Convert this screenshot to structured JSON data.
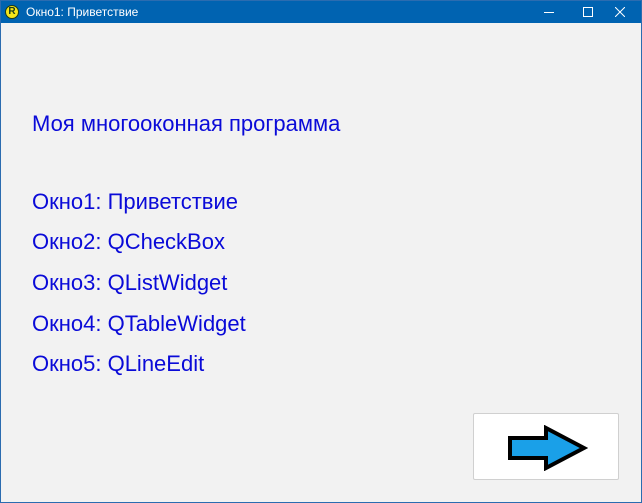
{
  "window": {
    "title": "Окно1: Приветствие",
    "app_icon_letter": "R",
    "controls": [
      "minimize-icon",
      "maximize-icon",
      "close-icon"
    ]
  },
  "main": {
    "heading": "Моя многооконная программа",
    "windows_list": [
      "Окно1: Приветствие",
      "Окно2: QCheckBox",
      "Окно3: QListWidget",
      "Окно4: QTableWidget",
      "Окно5: QLineEdit"
    ]
  },
  "next_button": {
    "icon": "arrow-right-icon"
  },
  "colors": {
    "titlebar": "#0063b1",
    "text": "#0a0ad8",
    "arrow_fill": "#1aa0e8"
  }
}
